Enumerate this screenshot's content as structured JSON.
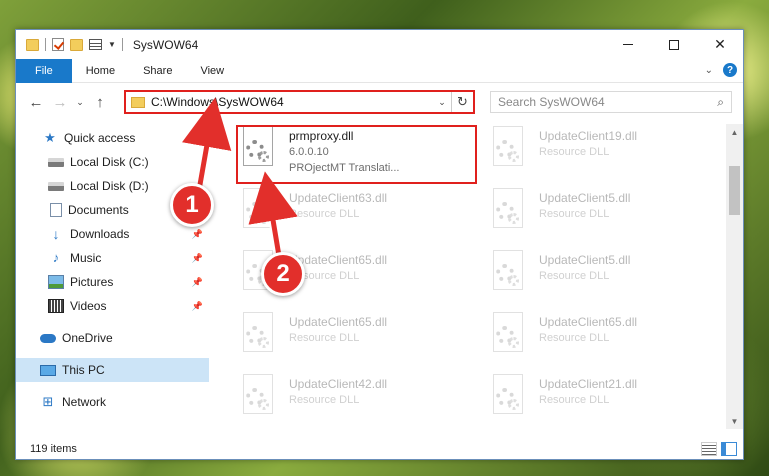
{
  "window": {
    "title": "SysWOW64",
    "controls": [
      "minimize",
      "maximize",
      "close"
    ],
    "close_glyph": "✕"
  },
  "quick_access_toolbar": {
    "icons": [
      "folder-icon",
      "checkmark-icon",
      "folder-icon",
      "properties-icon",
      "customize-dropdown-icon"
    ]
  },
  "ribbon": {
    "tabs": [
      "File",
      "Home",
      "Share",
      "View"
    ],
    "active_tab_color": "#1979ca"
  },
  "nav": {
    "back": "←",
    "forward": "→",
    "recent": "⌄",
    "up": "↑",
    "address": "C:\\Windows\\SysWOW64",
    "refresh": "↻",
    "address_dropdown": "⌄",
    "search_placeholder": "Search SysWOW64",
    "search_icon": "⌕"
  },
  "sidebar": {
    "items": [
      {
        "label": "Quick access",
        "icon": "star-icon",
        "pinned": false
      },
      {
        "label": "Local Disk (C:)",
        "icon": "disk-icon",
        "pinned": false
      },
      {
        "label": "Local Disk (D:)",
        "icon": "disk-icon",
        "pinned": false
      },
      {
        "label": "Documents",
        "icon": "documents-icon",
        "pinned": false
      },
      {
        "label": "Downloads",
        "icon": "download-icon",
        "pinned": true
      },
      {
        "label": "Music",
        "icon": "music-icon",
        "pinned": true
      },
      {
        "label": "Pictures",
        "icon": "pictures-icon",
        "pinned": true
      },
      {
        "label": "Videos",
        "icon": "videos-icon",
        "pinned": true
      },
      {
        "label": "OneDrive",
        "icon": "onedrive-icon",
        "pinned": false
      },
      {
        "label": "This PC",
        "icon": "pc-icon",
        "pinned": false,
        "selected": true
      },
      {
        "label": "Network",
        "icon": "network-icon",
        "pinned": false
      }
    ],
    "pin_glyph": "📌"
  },
  "files": [
    {
      "name": "prmproxy.dll",
      "line2": "6.0.0.10",
      "line3": "PROjectMT Translati...",
      "highlighted": true
    },
    {
      "name": "UpdateClient19.dll",
      "line2": "Resource DLL"
    },
    {
      "name": "UpdateClient63.dll",
      "line2": "Resource DLL"
    },
    {
      "name": "UpdateClient5.dll",
      "line2": "Resource DLL"
    },
    {
      "name": "UpdateClient65.dll",
      "line2": "Resource DLL"
    },
    {
      "name": "UpdateClient5.dll",
      "line2": "Resource DLL"
    },
    {
      "name": "UpdateClient65.dll",
      "line2": "Resource DLL"
    },
    {
      "name": "UpdateClient65.dll",
      "line2": "Resource DLL"
    },
    {
      "name": "UpdateClient42.dll",
      "line2": "Resource DLL"
    },
    {
      "name": "UpdateClient21.dll",
      "line2": "Resource DLL"
    }
  ],
  "status": {
    "item_count": "119 items"
  },
  "annotations": {
    "badge_1": "1",
    "badge_2": "2",
    "highlight_color": "#e0201d"
  }
}
